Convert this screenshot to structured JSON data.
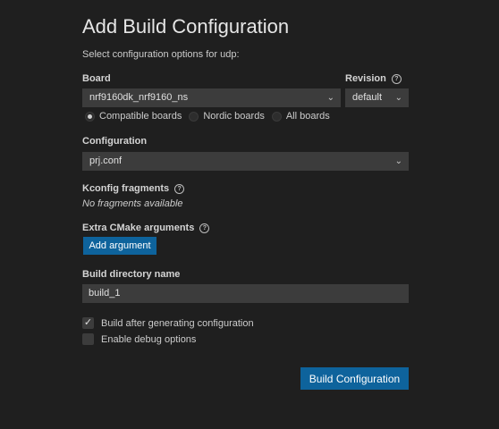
{
  "header": {
    "title": "Add Build Configuration",
    "subtitle": "Select configuration options for udp:"
  },
  "board": {
    "label": "Board",
    "value": "nrf9160dk_nrf9160_ns",
    "radio_options": [
      {
        "label": "Compatible boards",
        "selected": true
      },
      {
        "label": "Nordic boards",
        "selected": false
      },
      {
        "label": "All boards",
        "selected": false
      }
    ]
  },
  "revision": {
    "label": "Revision",
    "value": "default"
  },
  "configuration": {
    "label": "Configuration",
    "value": "prj.conf"
  },
  "kconfig": {
    "label": "Kconfig fragments",
    "empty_text": "No fragments available"
  },
  "cmake": {
    "label": "Extra CMake arguments",
    "add_label": "Add argument"
  },
  "build_dir": {
    "label": "Build directory name",
    "value": "build_1"
  },
  "options": [
    {
      "label": "Build after generating configuration",
      "checked": true
    },
    {
      "label": "Enable debug options",
      "checked": false
    }
  ],
  "submit_label": "Build Configuration",
  "colors": {
    "background": "#1f1f1f",
    "input_bg": "#3c3c3c",
    "primary_button": "#0e639c"
  }
}
